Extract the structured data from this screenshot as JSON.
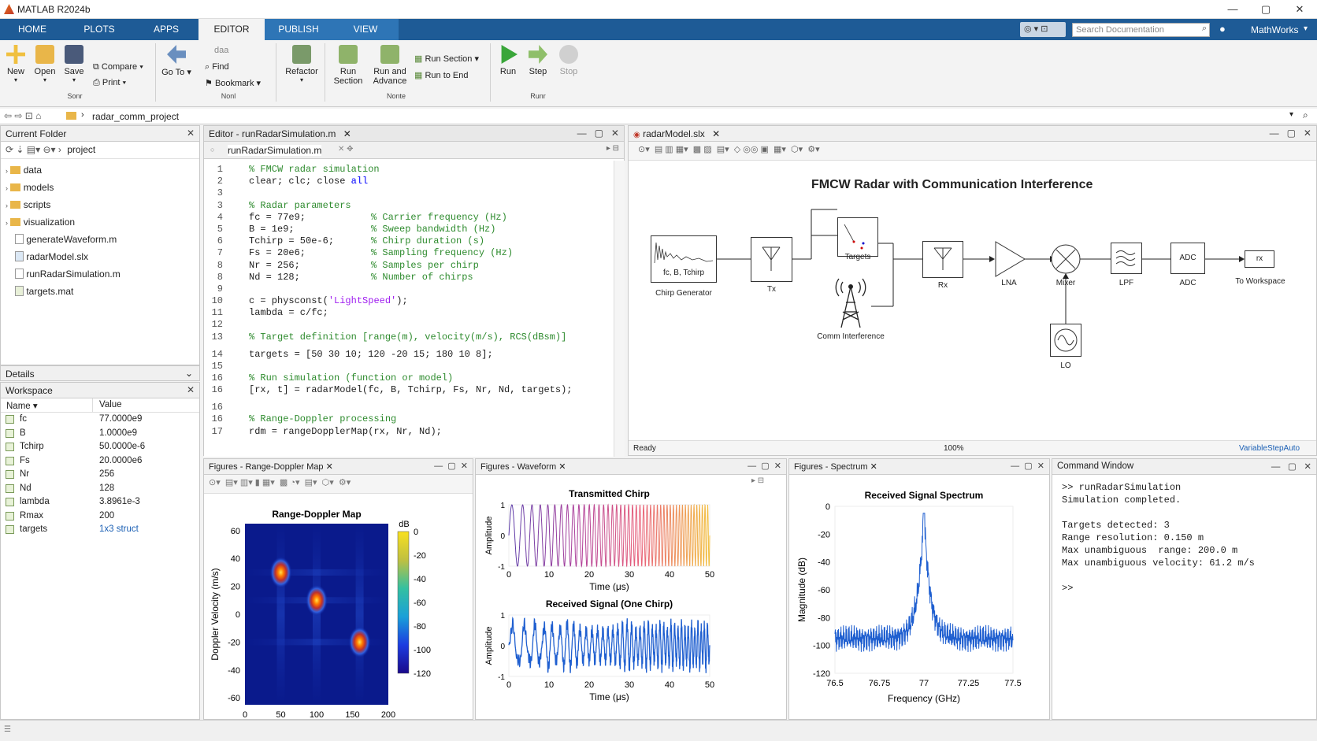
{
  "app_title": "MATLAB R2024b",
  "ribbon_tabs": [
    "HOME",
    "PLOTS",
    "APPS",
    "EDITOR",
    "PUBLISH",
    "VIEW"
  ],
  "search_placeholder": "Search Documentation",
  "account": "MathWorks",
  "ribbon": {
    "new": "New",
    "open": "Open",
    "save": "Save",
    "file_group": "Sonr",
    "compare": "Compare",
    "print": "Print",
    "go_to": "Go To",
    "daa": "daa",
    "find": "Find",
    "bookmark": "Bookmark",
    "nav_group": "Nonl",
    "refactor": "Refactor",
    "run_section": "Run\nSection",
    "run_and_advance": "Run and\nAdvance",
    "run_section2": "Run Section",
    "run_to_end": "Run to End",
    "section_group": "Nonte",
    "run": "Run",
    "step": "Step",
    "stop": "Stop",
    "run_group": "Runr"
  },
  "address_path": "radar_comm_project",
  "current_folder": {
    "title": "Current Folder",
    "path": "project",
    "items": [
      {
        "name": "data",
        "type": "folder"
      },
      {
        "name": "models",
        "type": "folder"
      },
      {
        "name": "scripts",
        "type": "folder"
      },
      {
        "name": "visualization",
        "type": "folder"
      },
      {
        "name": "generateWaveform.m",
        "type": "m"
      },
      {
        "name": "radarModel.slx",
        "type": "slx"
      },
      {
        "name": "runRadarSimulation.m",
        "type": "m"
      },
      {
        "name": "targets.mat",
        "type": "mat"
      }
    ]
  },
  "details_label": "Details",
  "workspace": {
    "title": "Workspace",
    "col_name": "Name",
    "col_value": "Value",
    "rows": [
      {
        "name": "fc",
        "value": "77.0000e9"
      },
      {
        "name": "B",
        "value": "1.0000e9"
      },
      {
        "name": "Tchirp",
        "value": "50.0000e-6"
      },
      {
        "name": "Fs",
        "value": "20.0000e6"
      },
      {
        "name": "Nr",
        "value": "256"
      },
      {
        "name": "Nd",
        "value": "128"
      },
      {
        "name": "lambda",
        "value": "3.8961e-3"
      },
      {
        "name": "Rmax",
        "value": "200"
      },
      {
        "name": "targets",
        "value": "1x3 struct"
      }
    ]
  },
  "editor": {
    "title": "Editor - runRadarSimulation.m",
    "tab": "runRadarSimulation.m",
    "lines": [
      {
        "n": "1",
        "code": "% FMCW radar simulation",
        "c": ""
      },
      {
        "n": "2",
        "code": "clear; clc; close ",
        "kw": "all",
        "c": ""
      },
      {
        "n": "3",
        "code": "",
        "c": ""
      },
      {
        "n": "3",
        "code": "% Radar parameters",
        "c": ""
      },
      {
        "n": "4",
        "code": "fc = 77e9;",
        "c": "% Carrier frequency (Hz)"
      },
      {
        "n": "5",
        "code": "B = 1e9;",
        "c": "% Sweep bandwidth (Hz)"
      },
      {
        "n": "6",
        "code": "Tchirp = 50e-6;",
        "c": "% Chirp duration (s)"
      },
      {
        "n": "7",
        "code": "Fs = 20e6;",
        "c": "% Sampling frequency (Hz)"
      },
      {
        "n": "8",
        "code": "Nr = 256;",
        "c": "% Samples per chirp"
      },
      {
        "n": "8",
        "code": "Nd = 128;",
        "c": "% Number of chirps"
      },
      {
        "n": "9",
        "code": "",
        "c": ""
      },
      {
        "n": "10",
        "code": "c = physconst(",
        "str": "'LightSpeed'",
        "tail": ");",
        "c": ""
      },
      {
        "n": "11",
        "code": "lambda = c/fc;",
        "c": ""
      },
      {
        "n": "12",
        "code": "",
        "c": ""
      },
      {
        "n": "13",
        "code": "% Target definition [range(m), velocity(m/s), RCS(dBsm)]",
        "c": ""
      },
      {
        "n": "14",
        "code": "targets = [50 30 10; 120 -20 15; 180 10 8];",
        "c": ""
      },
      {
        "n": "15",
        "code": "",
        "c": ""
      },
      {
        "n": "16",
        "code": "% Run simulation (function or model)",
        "c": ""
      },
      {
        "n": "16",
        "code": "[rx, t] = radarModel(fc, B, Tchirp, Fs, Nr, Nd, targets);",
        "c": ""
      },
      {
        "n": "16",
        "code": "",
        "c": ""
      },
      {
        "n": "16",
        "code": "% Range-Doppler processing",
        "c": ""
      },
      {
        "n": "17",
        "code": "rdm = rangeDopplerMap(rx, Nr, Nd);",
        "c": ""
      }
    ]
  },
  "simulink": {
    "tab": "radarModel.slx",
    "title": "FMCW Radar with Communication Interference",
    "blocks": {
      "chirp_inner": "fc, B, Tchirp",
      "chirp": "Chirp Generator",
      "tx": "Tx",
      "targets": "Targets",
      "comm": "Comm Interference",
      "rx": "Rx",
      "lna": "LNA",
      "mixer": "Mixer",
      "lpf": "LPF",
      "adc_inner": "ADC",
      "adc": "ADC",
      "rx_out": "rx",
      "to_ws": "To Workspace",
      "lo": "LO"
    },
    "status_left": "Ready",
    "status_zoom": "100%",
    "status_solver": "VariableStepAuto"
  },
  "fig_rdm": {
    "tab": "Figures - Range-Doppler Map",
    "title": "Range-Doppler Map",
    "xlabel": "Range (m)",
    "ylabel": "Doppler Velocity (m/s)",
    "cbar_label": "dB",
    "xticks": [
      "0",
      "50",
      "100",
      "150",
      "200"
    ],
    "yticks": [
      "60",
      "40",
      "20",
      "0",
      "-20",
      "-40",
      "-60"
    ],
    "cticks": [
      "0",
      "-20",
      "-40",
      "-60",
      "-80",
      "-100",
      "-120"
    ]
  },
  "fig_wave": {
    "tab": "Figures - Waveform",
    "title1": "Transmitted Chirp",
    "title2": "Received Signal (One Chirp)",
    "xlabel": "Time (μs)",
    "ylabel": "Amplitude",
    "xticks": [
      "0",
      "10",
      "20",
      "30",
      "40",
      "50"
    ],
    "yticks1": [
      "1",
      "0",
      "-1"
    ],
    "yticks2": [
      "1",
      "0",
      "-1"
    ]
  },
  "fig_spec": {
    "tab": "Figures - Spectrum",
    "title": "Received Signal Spectrum",
    "xlabel": "Frequency (GHz)",
    "ylabel": "Magnitude (dB)",
    "xticks": [
      "76.5",
      "76.75",
      "77",
      "77.25",
      "77.5"
    ],
    "yticks": [
      "0",
      "-20",
      "-40",
      "-60",
      "-80",
      "-100",
      "-120"
    ]
  },
  "command_window": {
    "title": "Command Window",
    "lines": [
      ">> runRadarSimulation",
      "Simulation completed.",
      "",
      "Targets detected: 3",
      "Range resolution: 0.150 m",
      "Max unambiguous  range: 200.0 m",
      "Max unambiguous velocity: 61.2 m/s",
      "",
      ">>"
    ]
  },
  "chart_data": [
    {
      "type": "heatmap",
      "title": "Range-Doppler Map",
      "xlabel": "Range (m)",
      "ylabel": "Doppler Velocity (m/s)",
      "xlim": [
        0,
        200
      ],
      "ylim": [
        -65,
        65
      ],
      "clim": [
        -120,
        0
      ],
      "colorbar_label": "dB",
      "peaks": [
        {
          "range": 50,
          "velocity": 30,
          "level_db": 0
        },
        {
          "range": 100,
          "velocity": 10,
          "level_db": 0
        },
        {
          "range": 160,
          "velocity": -20,
          "level_db": 0
        }
      ]
    },
    {
      "type": "line",
      "title": "Transmitted Chirp",
      "xlabel": "Time (μs)",
      "ylabel": "Amplitude",
      "xlim": [
        0,
        50
      ],
      "ylim": [
        -1,
        1
      ],
      "series": [
        {
          "kind": "linear chirp",
          "amplitude": 1,
          "cycles": 46
        }
      ]
    },
    {
      "type": "line",
      "title": "Received Signal (One Chirp)",
      "xlabel": "Time (μs)",
      "ylabel": "Amplitude",
      "xlim": [
        0,
        50
      ],
      "ylim": [
        -1,
        1
      ],
      "series": [
        {
          "kind": "noisy chirp",
          "amplitude": 0.8,
          "cycles": 40
        }
      ]
    },
    {
      "type": "line",
      "title": "Received Signal Spectrum",
      "xlabel": "Frequency (GHz)",
      "ylabel": "Magnitude (dB)",
      "xlim": [
        76.5,
        77.5
      ],
      "ylim": [
        -120,
        0
      ],
      "series": [
        {
          "kind": "spectrum",
          "peak_freq": 77,
          "peak_db": -5,
          "floor_db": -95
        }
      ]
    }
  ]
}
